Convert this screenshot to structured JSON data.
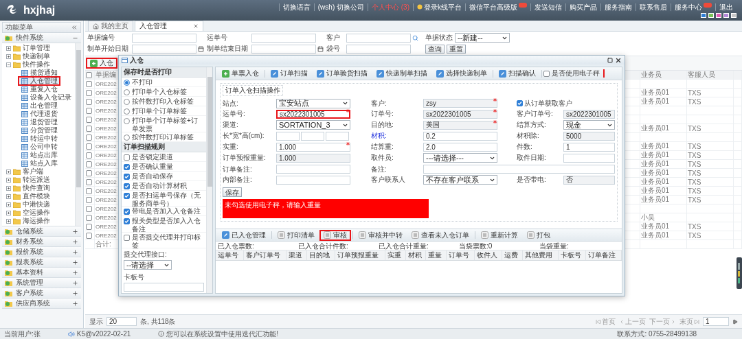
{
  "header": {
    "logo": "hxjhaj",
    "links": [
      {
        "label": "切换语言",
        "kind": "plain"
      },
      {
        "label": "(wsh) 切换公司",
        "kind": "plain"
      },
      {
        "label": "个人中心 (3)",
        "kind": "alert"
      },
      {
        "label": "登录k线平台",
        "kind": "icon"
      },
      {
        "label": "微信平台高级版",
        "kind": "badge"
      },
      {
        "label": "发送短信",
        "kind": "plain"
      },
      {
        "label": "购买产品",
        "kind": "plain"
      },
      {
        "label": "服务指南",
        "kind": "plain"
      },
      {
        "label": "联系售后",
        "kind": "plain"
      },
      {
        "label": "服务中心",
        "kind": "badge"
      },
      {
        "label": "退出",
        "kind": "plain"
      }
    ],
    "swatches": [
      {
        "color": "#2f7fd6"
      },
      {
        "color": "#7cc35a"
      },
      {
        "color": "#e35db5"
      },
      {
        "color": "#b58ad8"
      },
      {
        "color": "#c8c8c8"
      }
    ]
  },
  "sidebar": {
    "title": "功能菜单",
    "sections": [
      {
        "label": "快件系统",
        "expanded": true,
        "items": [
          {
            "label": "订单管理",
            "expanded": false
          },
          {
            "label": "快递制单",
            "expanded": false
          },
          {
            "label": "快件操作",
            "expanded": true,
            "children": [
              {
                "label": "揽货通知",
                "selected": false,
                "highlighted": false
              },
              {
                "label": "入仓管理",
                "selected": true,
                "highlighted": true
              },
              {
                "label": "重复入仓",
                "selected": false,
                "highlighted": false
              },
              {
                "label": "设备入仓记录",
                "selected": false,
                "highlighted": false
              },
              {
                "label": "出仓管理",
                "selected": false,
                "highlighted": false
              },
              {
                "label": "代理退货",
                "selected": false,
                "highlighted": false
              },
              {
                "label": "退货管理",
                "selected": false,
                "highlighted": false
              },
              {
                "label": "分货管理",
                "selected": false,
                "highlighted": false
              },
              {
                "label": "转运中转",
                "selected": false,
                "highlighted": false
              },
              {
                "label": "公司中转",
                "selected": false,
                "highlighted": false
              },
              {
                "label": "站点出库",
                "selected": false,
                "highlighted": false
              },
              {
                "label": "站点入库",
                "selected": false,
                "highlighted": false
              }
            ]
          },
          {
            "label": "客户端",
            "expanded": false
          },
          {
            "label": "转运派送",
            "expanded": false
          },
          {
            "label": "快件查询",
            "expanded": false
          },
          {
            "label": "直件模块",
            "expanded": false
          },
          {
            "label": "中港快递",
            "expanded": false
          },
          {
            "label": "空运操作",
            "expanded": false
          },
          {
            "label": "海运操作",
            "expanded": false
          }
        ]
      },
      {
        "label": "仓储系统",
        "expanded": false
      },
      {
        "label": "财务系统",
        "expanded": false
      },
      {
        "label": "报价系统",
        "expanded": false
      },
      {
        "label": "报表系统",
        "expanded": false
      },
      {
        "label": "基本资料",
        "expanded": false
      },
      {
        "label": "系统管理",
        "expanded": false
      },
      {
        "label": "客户系统",
        "expanded": false
      },
      {
        "label": "供应商系统",
        "expanded": false
      }
    ]
  },
  "tabs": [
    {
      "label": "我的主页",
      "selected": false,
      "closable": false
    },
    {
      "label": "入仓管理",
      "selected": true,
      "closable": true
    }
  ],
  "filters": [
    {
      "label": "单据编号",
      "kind": "text"
    },
    {
      "label": "运单号",
      "kind": "text"
    },
    {
      "label": "客户",
      "kind": "search"
    },
    {
      "label": "单据状态",
      "kind": "select",
      "value": "--新建--"
    },
    {
      "label": "制单开始日期",
      "kind": "date"
    },
    {
      "label": "制单结束日期",
      "kind": "date"
    },
    {
      "label": "袋号",
      "kind": "text"
    }
  ],
  "filter_buttons": [
    "查询",
    "重置"
  ],
  "toolbar_button": {
    "label": "入仓",
    "highlighted": true
  },
  "orders": {
    "columns": [
      "单据编",
      "业务员",
      "客服人员"
    ],
    "header_checked": false,
    "rows": [
      {
        "order_no": "ORE202",
        "checked": false
      },
      {
        "order_no": "ORE202",
        "checked": false,
        "salesperson": "业务员01",
        "service_staff": "TXS"
      },
      {
        "order_no": "ORE202",
        "checked": false,
        "salesperson": "业务员01",
        "service_staff": "TXS"
      },
      {
        "order_no": "ORE202",
        "checked": false
      },
      {
        "order_no": "ORE202",
        "checked": false
      },
      {
        "order_no": "ORE202",
        "checked": false,
        "salesperson": "业务员01",
        "service_staff": "TXS"
      },
      {
        "order_no": "ORE202",
        "checked": false
      },
      {
        "order_no": "ORE202",
        "checked": false,
        "salesperson": "业务员01",
        "service_staff": "TXS"
      },
      {
        "order_no": "ORE202",
        "checked": false,
        "salesperson": "业务员01",
        "service_staff": "TXS"
      },
      {
        "order_no": "ORE202",
        "checked": false,
        "salesperson": "业务员01",
        "service_staff": "TXS"
      },
      {
        "order_no": "ORE202",
        "checked": false,
        "salesperson": "业务员01",
        "service_staff": "TXS"
      },
      {
        "order_no": "ORE202",
        "checked": false,
        "salesperson": "业务员01",
        "service_staff": "TXS"
      },
      {
        "order_no": "ORE202",
        "checked": false,
        "salesperson": "业务员01",
        "service_staff": "TXS"
      },
      {
        "order_no": "ORE202",
        "checked": false,
        "salesperson": "业务员01",
        "service_staff": "TXS"
      },
      {
        "order_no": "ORE202",
        "checked": false
      },
      {
        "order_no": "ORE202",
        "checked": false,
        "salesperson": "小吴"
      },
      {
        "order_no": "ORE202",
        "checked": false,
        "salesperson": "业务员01",
        "service_staff": "TXS"
      },
      {
        "order_no": "ORE202",
        "checked": false,
        "salesperson": "业务员01",
        "service_staff": "TXS"
      }
    ],
    "total": "合计:"
  },
  "pagination": {
    "show_label": "显示",
    "page_size": "20",
    "summary": "条, 共118条",
    "buttons": [
      {
        "label": "首页",
        "kind": "first"
      },
      {
        "label": "上一页",
        "kind": "prev"
      },
      {
        "label": "下一页",
        "kind": "next"
      },
      {
        "label": "末页",
        "kind": "last"
      }
    ],
    "page": "1"
  },
  "dialog": {
    "title": "入仓",
    "print_section": {
      "title": "保存时是否打印",
      "options": [
        {
          "label": "不打印",
          "selected": true
        },
        {
          "label": "打印单个入仓标签",
          "selected": false
        },
        {
          "label": "按件数打印入仓标签",
          "selected": false
        },
        {
          "label": "打印单个订单标签",
          "selected": false
        },
        {
          "label": "打印单个订单标签+订单发票",
          "selected": false
        },
        {
          "label": "按件数打印订单标签",
          "selected": false
        }
      ]
    },
    "rules_section": {
      "title": "订单扫描规则",
      "rules": [
        {
          "label": "是否锁定渠道",
          "checked": false
        },
        {
          "label": "是否确认重量",
          "checked": true
        },
        {
          "label": "是否自动保存",
          "checked": true
        },
        {
          "label": "是否自动计算材积",
          "checked": true
        },
        {
          "label": "是否扫运单号保存（无服务商单号）",
          "checked": true
        },
        {
          "label": "带电是否加入入仓备注",
          "checked": true
        },
        {
          "label": "报关类型是否加入入仓备注",
          "checked": true
        },
        {
          "label": "是否提交代理并打印标签",
          "checked": false
        }
      ]
    },
    "agent_interface": {
      "label": "提交代理接口:",
      "value": "--请选择"
    },
    "pallet": {
      "label": "卡板号"
    },
    "scan_toolbar": {
      "buttons": [
        {
          "label": "单票入仓",
          "kind": "add"
        },
        {
          "label": "订单扫描",
          "kind": "edit"
        },
        {
          "label": "订单验货扫描",
          "kind": "edit"
        },
        {
          "label": "快递制单扫描",
          "kind": "edit"
        },
        {
          "label": "选择快递制单",
          "kind": "edit"
        },
        {
          "label": "扫描确认",
          "kind": "edit"
        }
      ],
      "scale": {
        "label": "是否使用电子秤",
        "checked": false
      }
    },
    "scan_form": {
      "legend": "订单入仓扫描操作",
      "rows": [
        [
          {
            "label": "站点:",
            "kind": "select",
            "value": "宝安站点"
          },
          {
            "label": "客户:",
            "kind": "readonly",
            "value": "zsy",
            "required": true
          },
          {
            "kind": "checkbox",
            "label": "从订单获取客户",
            "checked": true
          }
        ],
        [
          {
            "label": "运单号:",
            "kind": "input",
            "value": "sx2022301005",
            "required": true,
            "highlighted": true
          },
          {
            "label": "订单号:",
            "kind": "readonly",
            "value": "sx2022301005",
            "required": true
          },
          {
            "label": "客户订单号:",
            "kind": "readonly",
            "value": "sx2022301005"
          }
        ],
        [
          {
            "label": "渠道:",
            "kind": "select",
            "value": "SORTATION_3"
          },
          {
            "label": "目的地:",
            "kind": "readonly",
            "value": "美国",
            "required": true
          },
          {
            "label": "结算方式:",
            "kind": "select",
            "value": "现金"
          }
        ],
        [
          {
            "label": "长*宽*高(cm):",
            "kind": "dims"
          },
          {
            "label": "材积:",
            "kind": "input",
            "value": "0.2",
            "link": true
          },
          {
            "label": "材积除:",
            "kind": "readonly",
            "value": "5000"
          }
        ],
        [
          {
            "label": "实重:",
            "kind": "input",
            "value": "1.000",
            "required": true
          },
          {
            "label": "结算重:",
            "kind": "input",
            "value": "2.0"
          },
          {
            "label": "件数:",
            "kind": "input",
            "value": "1"
          }
        ],
        [
          {
            "label": "订单预报重量:",
            "kind": "readonly",
            "value": "1.000"
          },
          {
            "label": "取件员:",
            "kind": "select",
            "value": "---请选择---"
          },
          {
            "label": "取件日期:",
            "kind": "input"
          }
        ],
        [
          {
            "label": "订单备注:",
            "kind": "input"
          },
          {
            "label": "备注:",
            "kind": "wide"
          }
        ],
        [
          {
            "label": "内部备注:",
            "kind": "input"
          },
          {
            "label": "客户联系人",
            "kind": "select",
            "value": "不存在客户联系"
          },
          {
            "label": "是否带电:",
            "kind": "readonly",
            "value": "否"
          }
        ]
      ],
      "save": "保存",
      "alert": "未勾选使用电子秤，请输入重量"
    },
    "list_toolbar": [
      {
        "label": "已入仓管理",
        "kind": "edit",
        "highlighted": false
      },
      {
        "label": "打印清单",
        "kind": "plain",
        "highlighted": false
      },
      {
        "label": "审核",
        "kind": "plain",
        "highlighted": true
      },
      {
        "label": "审核并中转",
        "kind": "plain",
        "highlighted": false
      },
      {
        "label": "查看未入仓订单",
        "kind": "plain",
        "highlighted": false
      },
      {
        "label": "重新计算",
        "kind": "plain",
        "highlighted": false
      },
      {
        "label": "打包",
        "kind": "plain",
        "highlighted": false
      }
    ],
    "summary": [
      "已入仓票数:",
      "已入仓合计件数:",
      "已入仓合计重量:",
      "当袋票数:0",
      "当袋重量:"
    ],
    "list_columns": [
      "运单号",
      "客户订单号",
      "渠道",
      "目的地",
      "订单预报重量",
      "实重",
      "材积",
      "重量",
      "订单号",
      "收件人",
      "运费",
      "其他费用",
      "卡板号",
      "订单备注"
    ]
  },
  "status_bar": {
    "user": "当前用户:张",
    "version": "K5@v2022-02-21",
    "notice": "您可以在系统设置中使用迭代汇功能!",
    "contact": "联系方式: 0755-28499138"
  }
}
